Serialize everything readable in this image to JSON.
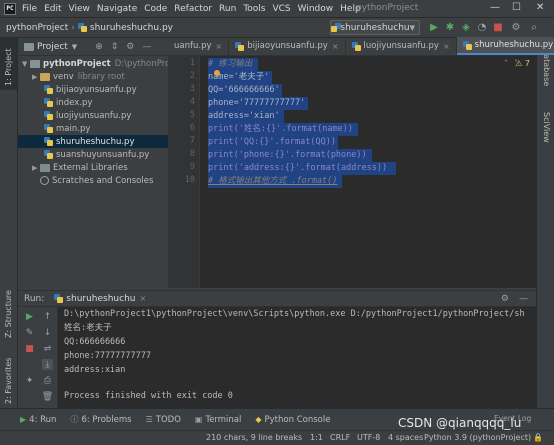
{
  "menu": {
    "logo": "PC",
    "items": [
      "File",
      "Edit",
      "View",
      "Navigate",
      "Code",
      "Refactor",
      "Run",
      "Tools",
      "VCS",
      "Window",
      "Help"
    ],
    "window_title": "pythonProject"
  },
  "nav": {
    "project": "pythonProject",
    "file": "shuruheshuchu.py",
    "run_config": "shuruheshuchu"
  },
  "side_tabs": {
    "left_top": "1: Project",
    "left_structure": "Z: Structure",
    "left_favorites": "2: Favorites",
    "right_database": "Database",
    "right_sciview": "SciView"
  },
  "project_panel": {
    "header": "Project",
    "root_name": "pythonProject",
    "root_path": "D:\\pythonProjec",
    "venv": "venv",
    "venv_hint": "library root",
    "files": [
      "bijiaoyunsuanfu.py",
      "index.py",
      "luojiyunsuanfu.py",
      "main.py",
      "shuruheshuchu.py",
      "suanshuyunsuanfu.py"
    ],
    "external": "External Libraries",
    "scratches": "Scratches and Consoles"
  },
  "editor": {
    "tabs": [
      "uanfu.py",
      "bijiaoyunsuanfu.py",
      "luojiyunsuanfu.py",
      "shuruheshuchu.py"
    ],
    "inspection": "⚠ 7",
    "line_numbers": [
      "1",
      "2",
      "3",
      "4",
      "5",
      "6",
      "7",
      "8",
      "9",
      "10"
    ],
    "lines": [
      "# 练习输出",
      "name='老夫子'",
      "QQ='666666666'",
      "phone='77777777777'",
      "address='xian'",
      "print('姓名:{}'.format(name))",
      "print('QQ:{}'.format(QQ))",
      "print('phone:{}'.format(phone))",
      "print('address:{}'.format(address))",
      "# 格式输出其他方式 .format()"
    ]
  },
  "run": {
    "label": "Run:",
    "tab": "shuruheshuchu",
    "output": [
      "D:\\pythonProject1\\pythonProject\\venv\\Scripts\\python.exe D:/pythonProject1/pythonProject/sh",
      "姓名:老夫子",
      "QQ:666666666",
      "phone:77777777777",
      "address:xian",
      "",
      "Process finished with exit code 0"
    ]
  },
  "bottom_tools": [
    "4: Run",
    "6: Problems",
    "TODO",
    "Terminal",
    "Python Console"
  ],
  "status": {
    "chars": "210 chars, 9 line breaks",
    "position": "1:1",
    "line_sep": "CRLF",
    "encoding": "UTF-8",
    "indent": "4 spaces",
    "interpreter": "Python 3.9 (pythonProject)",
    "event_log": "Event Log"
  },
  "watermark": "CSDN @qianqqqq_lu",
  "colors": {
    "selection": "#214283",
    "keyword": "#cc7832",
    "string": "#6a8759",
    "comment": "#808080",
    "run_green": "#59a869"
  }
}
